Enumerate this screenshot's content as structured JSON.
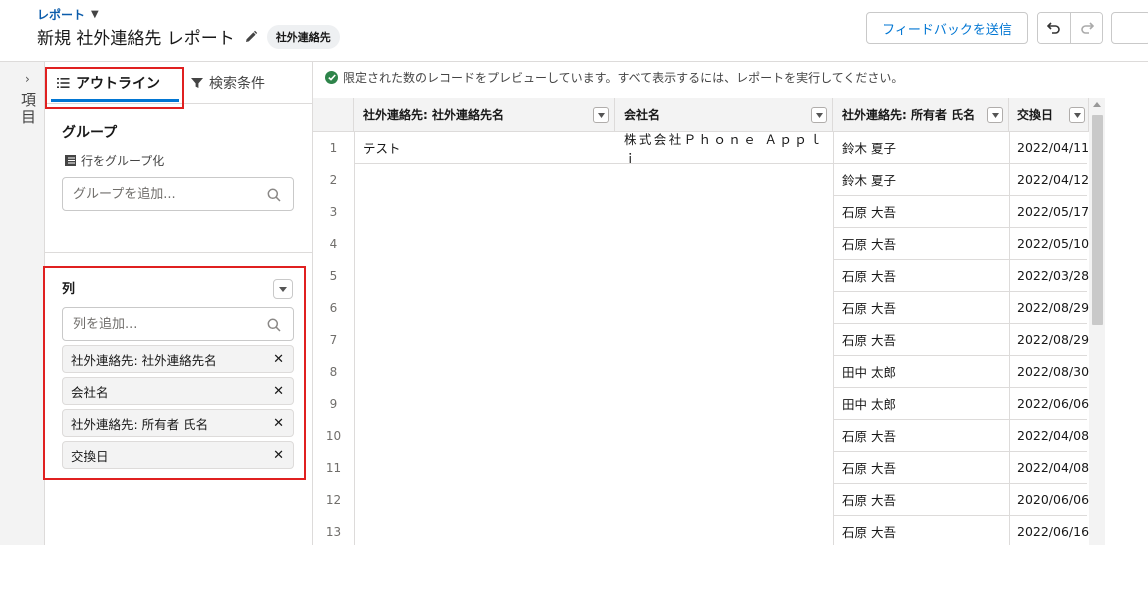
{
  "header": {
    "breadcrumb": "レポート",
    "title": "新規 社外連絡先 レポート",
    "badge": "社外連絡先",
    "feedback_button": "フィードバックを送信"
  },
  "rail": {
    "label": "項目"
  },
  "panel": {
    "tabs": {
      "outline": "アウトライン",
      "filters": "検索条件"
    },
    "groups": {
      "title": "グループ",
      "subtitle": "行をグループ化",
      "search_placeholder": "グループを追加..."
    },
    "columns": {
      "title": "列",
      "search_placeholder": "列を追加...",
      "items": [
        {
          "label": "社外連絡先: 社外連絡先名"
        },
        {
          "label": "会社名"
        },
        {
          "label": "社外連絡先: 所有者 氏名"
        },
        {
          "label": "交換日"
        }
      ]
    }
  },
  "preview": {
    "notice": "限定された数のレコードをプレビューしています。すべて表示するには、レポートを実行してください。",
    "headers": [
      "社外連絡先: 社外連絡先名",
      "会社名",
      "社外連絡先: 所有者 氏名",
      "交換日"
    ],
    "rows": [
      {
        "num": "1",
        "name": "テスト",
        "company": "株式会社Ｐｈｏｎｅ Ａｐｐｌｉ",
        "owner": "鈴木 夏子",
        "date": "2022/04/11"
      },
      {
        "num": "2",
        "name": "",
        "company": "",
        "owner": "鈴木 夏子",
        "date": "2022/04/12"
      },
      {
        "num": "3",
        "name": "",
        "company": "",
        "owner": "石原 大吾",
        "date": "2022/05/17"
      },
      {
        "num": "4",
        "name": "",
        "company": "",
        "owner": "石原 大吾",
        "date": "2022/05/10"
      },
      {
        "num": "5",
        "name": "",
        "company": "",
        "owner": "石原 大吾",
        "date": "2022/03/28"
      },
      {
        "num": "6",
        "name": "",
        "company": "",
        "owner": "石原 大吾",
        "date": "2022/08/29"
      },
      {
        "num": "7",
        "name": "",
        "company": "",
        "owner": "石原 大吾",
        "date": "2022/08/29"
      },
      {
        "num": "8",
        "name": "",
        "company": "",
        "owner": "田中 太郎",
        "date": "2022/08/30"
      },
      {
        "num": "9",
        "name": "",
        "company": "",
        "owner": "田中 太郎",
        "date": "2022/06/06"
      },
      {
        "num": "10",
        "name": "",
        "company": "",
        "owner": "石原 大吾",
        "date": "2022/04/08"
      },
      {
        "num": "11",
        "name": "",
        "company": "",
        "owner": "石原 大吾",
        "date": "2022/04/08"
      },
      {
        "num": "12",
        "name": "",
        "company": "",
        "owner": "石原 大吾",
        "date": "2020/06/06"
      },
      {
        "num": "13",
        "name": "",
        "company": "",
        "owner": "石原 大吾",
        "date": "2022/06/16"
      }
    ]
  },
  "colors": {
    "accent": "#0176d3",
    "highlight": "#e02020",
    "success": "#2e844a"
  }
}
